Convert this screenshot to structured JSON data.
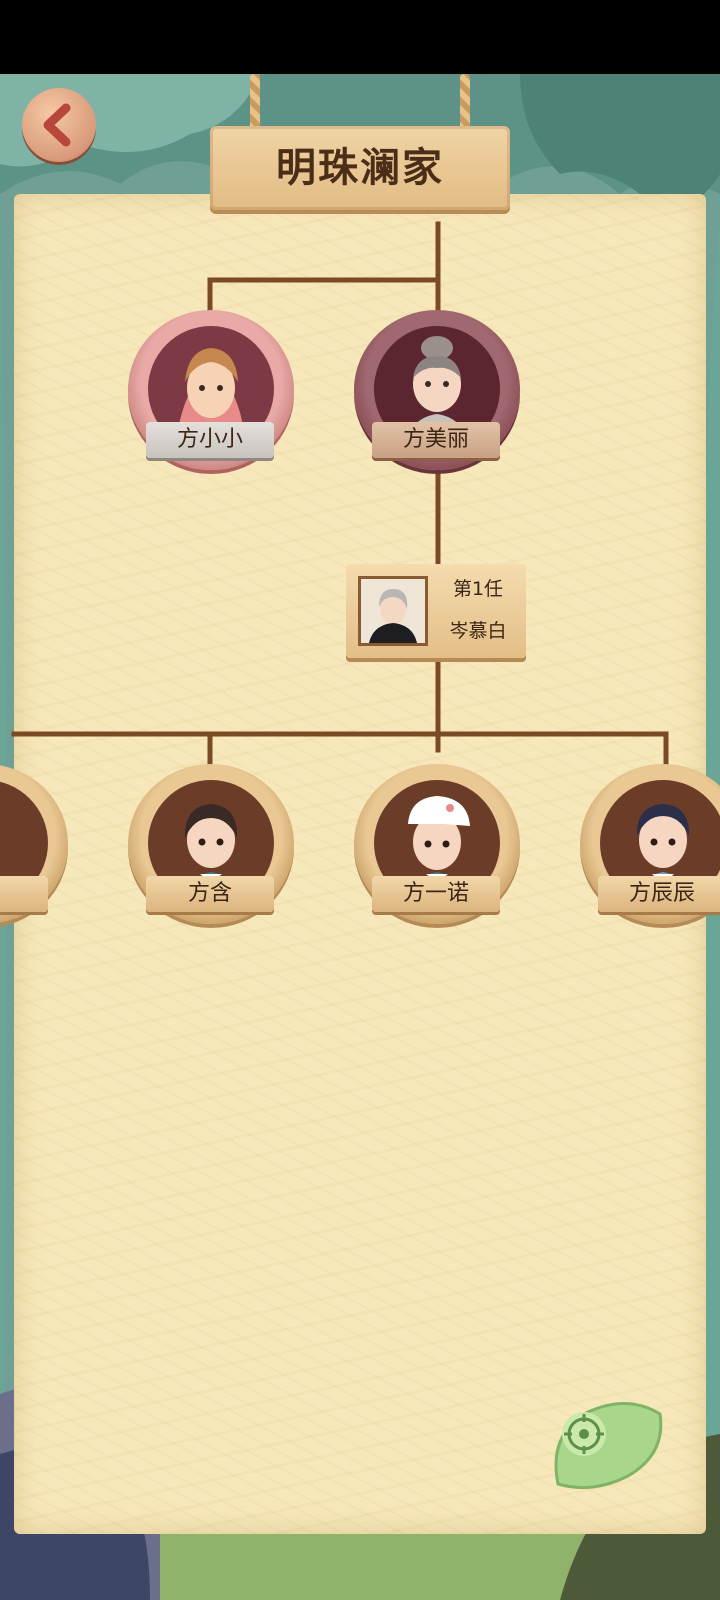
{
  "title": "明珠澜家",
  "parents": [
    {
      "name": "方小小",
      "style": "pink"
    },
    {
      "name": "方美丽",
      "style": "dark"
    }
  ],
  "spouse": {
    "rank": "第1任",
    "name": "岑慕白"
  },
  "children": [
    {
      "name": ""
    },
    {
      "name": "方含"
    },
    {
      "name": "方一诺"
    },
    {
      "name": "方辰辰"
    }
  ],
  "icons": {
    "back": "back-arrow-icon",
    "locate": "locate-crosshair-icon"
  },
  "colors": {
    "paper": "#f7e8bb",
    "line": "#7a4a24",
    "title_text": "#4a2e18"
  }
}
